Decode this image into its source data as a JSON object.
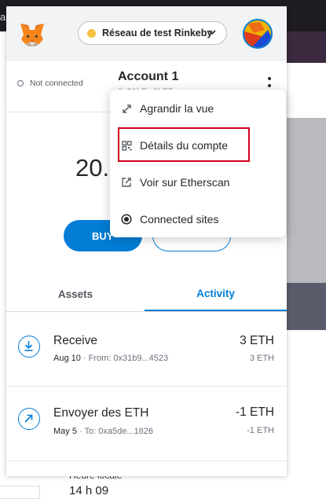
{
  "background": {
    "partial_text_left": "an",
    "label_below": "Heure locale",
    "time_below": "14 h 09"
  },
  "header": {
    "network_name": "Réseau de test Rinkeby",
    "network_dot_color": "#f6c343"
  },
  "account": {
    "connection_status": "Not connected",
    "name": "Account 1",
    "address_short": "0x31bF...0bF7"
  },
  "balance": {
    "amount": "20."
  },
  "actions": {
    "buy_label": "BUY"
  },
  "tabs": {
    "assets": "Assets",
    "activity": "Activity"
  },
  "transactions": [
    {
      "title": "Receive",
      "date": "Aug 10",
      "detail": " · From: 0x31b9...4523",
      "amount": "3 ETH",
      "amount_secondary": "3 ETH",
      "icon": "receive-icon"
    },
    {
      "title": "Envoyer des ETH",
      "date": "May 5",
      "detail": " · To: 0xa5de...1826",
      "amount": "-1 ETH",
      "amount_secondary": "-1 ETH",
      "icon": "send-icon"
    }
  ],
  "menu": {
    "items": [
      {
        "label": "Agrandir la vue",
        "icon": "expand-icon"
      },
      {
        "label": "Détails du compte",
        "icon": "qr-code-icon"
      },
      {
        "label": "Voir sur Etherscan",
        "icon": "external-link-icon"
      },
      {
        "label": "Connected sites",
        "icon": "connected-sites-icon"
      }
    ]
  },
  "colors": {
    "accent": "#037dd6",
    "highlight": "#d0021b"
  }
}
